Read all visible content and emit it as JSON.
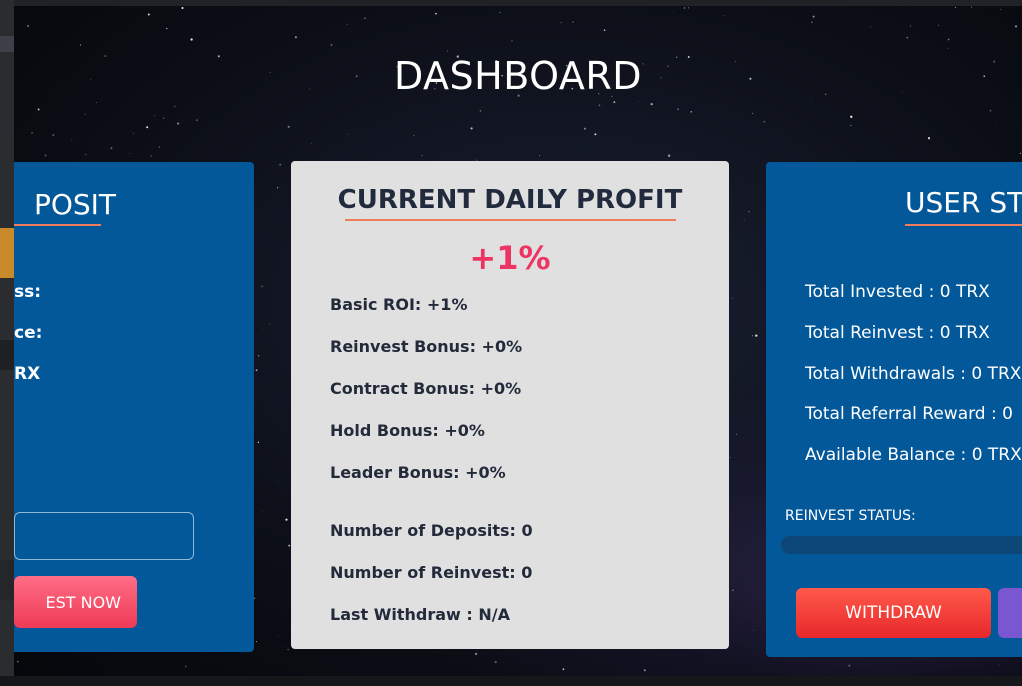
{
  "dashboard": {
    "title": "DASHBOARD"
  },
  "deposit_card": {
    "title": "POSIT",
    "labels": [
      "ss:",
      "ce:",
      "RX"
    ],
    "invest_button": "EST NOW"
  },
  "profit_card": {
    "title": "CURRENT DAILY PROFIT",
    "value": "+1%",
    "stats": [
      "Basic ROI: +1%",
      "Reinvest Bonus: +0%",
      "Contract Bonus: +0%",
      "Hold Bonus: +0%",
      "Leader Bonus: +0%",
      "Number of Deposits: 0",
      "Number of Reinvest: 0",
      "Last Withdraw : N/A"
    ]
  },
  "user_card": {
    "title": "USER STA",
    "stats": [
      "Total Invested : 0 TRX",
      "Total Reinvest : 0 TRX",
      "Total Withdrawals : 0 TRX",
      "Total Referral Reward : 0",
      "Available Balance : 0 TRX"
    ],
    "reinvest_label": "REINVEST STATUS:",
    "reinvest_progress": 0,
    "withdraw_button": "WITHDRAW"
  },
  "colors": {
    "card_blue": "#03589a",
    "card_grey": "#e0e0e0",
    "accent_pink": "#ee3463",
    "underline": "#f07a5c",
    "withdraw_red": "#e8272b",
    "purple": "#7b56d1"
  }
}
